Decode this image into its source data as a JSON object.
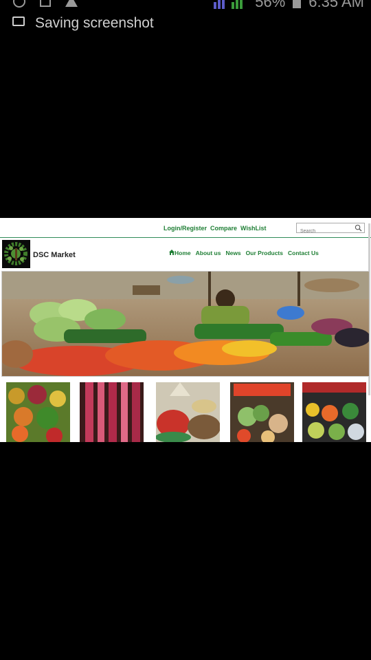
{
  "status_bar": {
    "battery_percent_text": "56%",
    "time_text": "6:35 AM",
    "notification_text": "Saving screenshot"
  },
  "site": {
    "top_links": [
      "Login/Register",
      "Compare",
      "WishList"
    ],
    "search": {
      "placeholder": "Search"
    },
    "brand": "DSC Market",
    "nav": {
      "home": "Home",
      "about": "About us",
      "news": "News",
      "products": "Our Products",
      "contact": "Contact Us"
    }
  },
  "colors": {
    "accent_green": "#1e7e34",
    "page_background": "#000000",
    "web_background": "#ffffff"
  },
  "icons": [
    "whatsapp-icon",
    "gallery-icon",
    "warning-icon",
    "signal-icon",
    "battery-icon",
    "image-icon",
    "search-icon",
    "home-icon",
    "tree-logo"
  ],
  "images": {
    "hero": "market-stall-hero",
    "thumbnails": [
      "fruit-stall",
      "meat-stall",
      "spices-grains-stall",
      "vegetables-stall",
      "produce-stall"
    ]
  }
}
